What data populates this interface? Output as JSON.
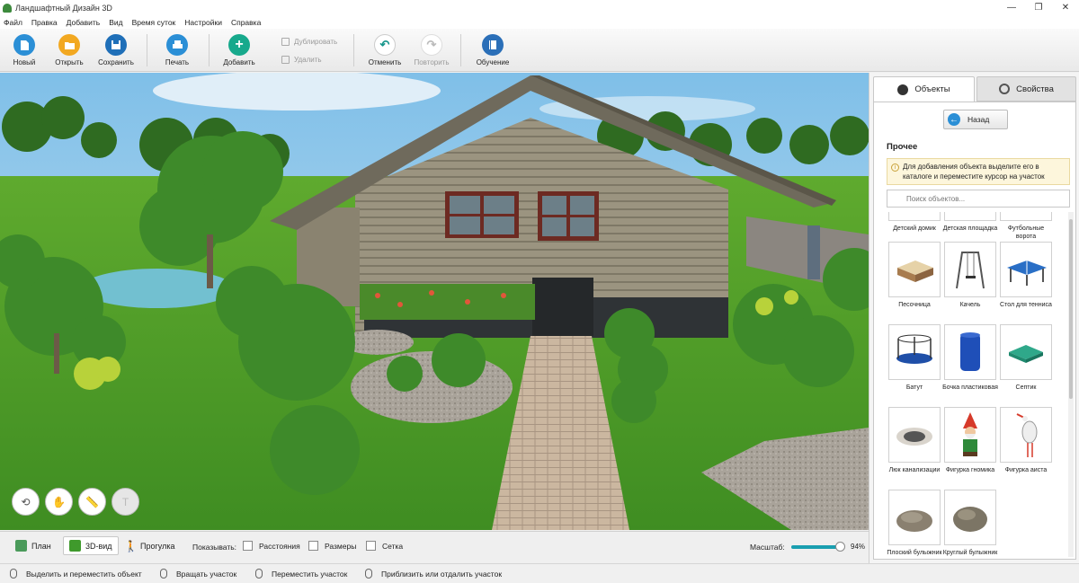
{
  "window": {
    "title": "Ландшафтный Дизайн 3D",
    "min": "—",
    "max": "❐",
    "close": "✕"
  },
  "menu": [
    "Файл",
    "Правка",
    "Добавить",
    "Вид",
    "Время суток",
    "Настройки",
    "Справка"
  ],
  "toolbar": {
    "new": "Новый",
    "open": "Открыть",
    "save": "Сохранить",
    "print": "Печать",
    "add": "Добавить",
    "duplicate": "Дублировать",
    "delete": "Удалить",
    "undo": "Отменить",
    "redo": "Повторить",
    "tutorial": "Обучение"
  },
  "viewtabs": {
    "plan": "План",
    "view3d": "3D-вид",
    "walk": "Прогулка"
  },
  "display": {
    "label": "Показывать:",
    "distances": "Расстояния",
    "sizes": "Размеры",
    "grid": "Сетка"
  },
  "scale": {
    "label": "Масштаб:",
    "value": "94%",
    "fraction": 0.94
  },
  "status": [
    "Выделить и переместить объект",
    "Вращать участок",
    "Переместить участок",
    "Приблизить или отдалить участок"
  ],
  "panel": {
    "tab_objects": "Объекты",
    "tab_properties": "Свойства",
    "back": "Назад",
    "category": "Прочее",
    "info": "Для добавления объекта выделите его в каталоге и переместите курсор на участок",
    "search_placeholder": "Поиск объектов...",
    "items": [
      "Детский домик",
      "Детская площадка",
      "Футбольные ворота",
      "Песочница",
      "Качель",
      "Стол для тенниса",
      "Батут",
      "Бочка пластиковая",
      "Септик",
      "Люк канализации",
      "Фигурка гномика",
      "Фигурка аиста",
      "Плоский булыжник",
      "Круглый булыжник"
    ]
  },
  "colors": {
    "accent": "#1a9fb0",
    "new_icon": "#2b8fd6",
    "open_icon": "#f2a821",
    "save_icon": "#1f6fb8",
    "add_icon": "#17a98c",
    "undo_icon": "#17968b",
    "tutorial_icon": "#2b6fb8"
  }
}
